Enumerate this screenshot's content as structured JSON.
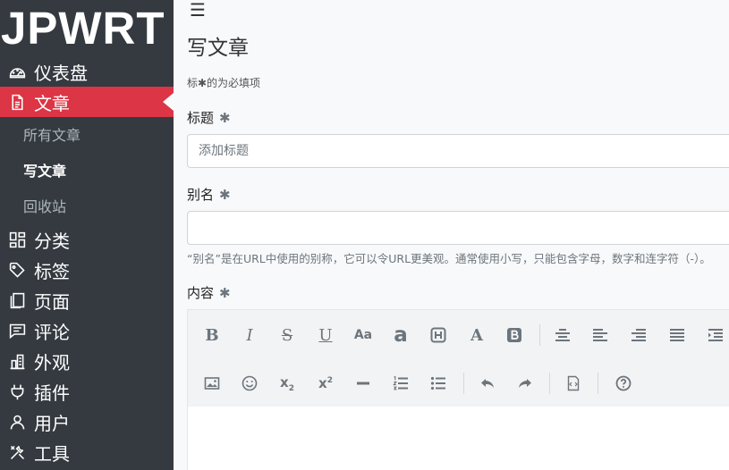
{
  "sidebar": {
    "brand": "JPWRT",
    "items": [
      {
        "label": "仪表盘",
        "icon": "dashboard-icon"
      },
      {
        "label": "文章",
        "icon": "document-icon"
      },
      {
        "label": "分类",
        "icon": "category-icon"
      },
      {
        "label": "标签",
        "icon": "tag-icon"
      },
      {
        "label": "页面",
        "icon": "pages-icon"
      },
      {
        "label": "评论",
        "icon": "comment-icon"
      },
      {
        "label": "外观",
        "icon": "appearance-icon"
      },
      {
        "label": "插件",
        "icon": "plugin-icon"
      },
      {
        "label": "用户",
        "icon": "user-icon"
      },
      {
        "label": "工具",
        "icon": "tools-icon"
      }
    ],
    "sub_items": [
      {
        "label": "所有文章"
      },
      {
        "label": "写文章"
      },
      {
        "label": "回收站"
      }
    ],
    "active_color": "#dc3545",
    "background": "#343a40"
  },
  "main": {
    "menu_glyph": "☰",
    "title": "写文章",
    "required_note": "标✱的为必填项",
    "fields": {
      "title": {
        "label": "标题",
        "star": "✱",
        "placeholder": "添加标题",
        "value": ""
      },
      "slug": {
        "label": "别名",
        "star": "✱",
        "placeholder": "",
        "value": "",
        "help": "“别名”是在URL中使用的别称，它可以令URL更美观。通常使用小写，只能包含字母，数字和连字符（-）。"
      },
      "content": {
        "label": "内容",
        "star": "✱"
      }
    },
    "toolbar_row1": [
      "bold-icon",
      "italic-icon",
      "strikethrough-icon",
      "underline-icon",
      "font-size-icon",
      "font-family-icon",
      "heading-icon",
      "text-color-icon",
      "background-color-icon",
      "align-center-icon",
      "align-left-icon",
      "align-right-icon",
      "justify-icon",
      "indent-icon"
    ],
    "toolbar_row2": [
      "image-icon",
      "emoji-icon",
      "subscript-icon",
      "superscript-icon",
      "horizontal-rule-icon",
      "ordered-list-icon",
      "unordered-list-icon",
      "undo-icon",
      "redo-icon",
      "code-view-icon",
      "help-icon"
    ]
  }
}
